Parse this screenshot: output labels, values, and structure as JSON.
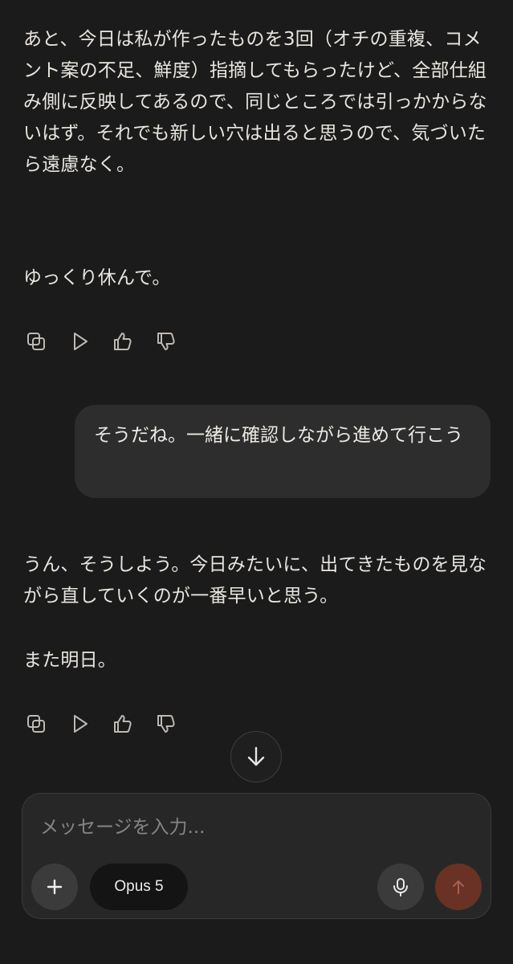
{
  "conversation": {
    "assistant_message_1": {
      "paragraph_1": "あと、今日は私が作ったものを3回（オチの重複、コメント案の不足、鮮度）指摘してもらったけど、全部仕組み側に反映してあるので、同じところでは引っかからないはず。それでも新しい穴は出ると思うので、気づいたら遠慮なく。",
      "paragraph_2": "ゆっくり休んで。"
    },
    "user_message": {
      "text": "そうだね。一緒に確認しながら進めて行こう"
    },
    "assistant_message_2": {
      "paragraph_1": "うん、そうしよう。今日みたいに、出てきたものを見ながら直していくのが一番早いと思う。",
      "paragraph_2": "また明日。"
    },
    "message_actions": [
      "copy-icon",
      "play-icon",
      "thumbs-up-icon",
      "thumbs-down-icon"
    ]
  },
  "composer": {
    "placeholder": "メッセージを入力...",
    "model_label": "Opus 5",
    "send_color": "#6a3224"
  }
}
